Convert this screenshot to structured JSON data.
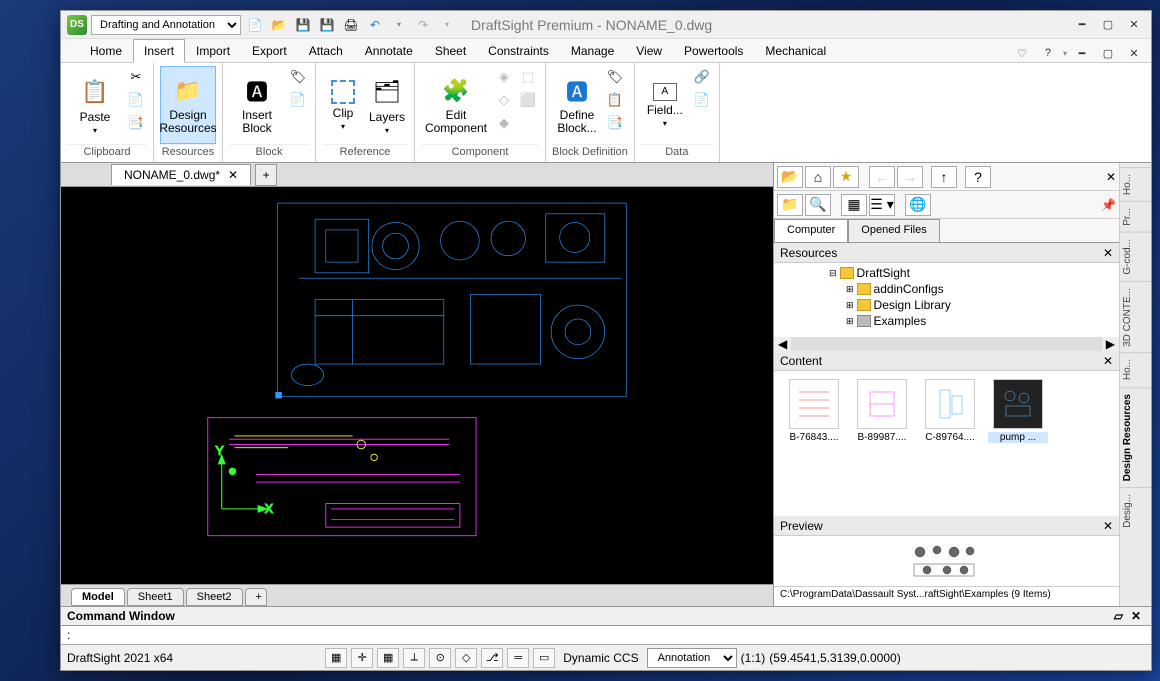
{
  "app": {
    "title": "DraftSight Premium - NONAME_0.dwg",
    "workspace_selected": "Drafting and Annotation",
    "logo_text": "DS"
  },
  "menu": {
    "tabs": [
      "Home",
      "Insert",
      "Import",
      "Export",
      "Attach",
      "Annotate",
      "Sheet",
      "Constraints",
      "Manage",
      "View",
      "Powertools",
      "Mechanical"
    ],
    "active": "Insert"
  },
  "ribbon": {
    "groups": [
      {
        "label": "Clipboard",
        "items": [
          {
            "big": "Paste",
            "sub": "▾"
          }
        ]
      },
      {
        "label": "Resources",
        "items": [
          {
            "big": "Design Resources",
            "active": true
          }
        ]
      },
      {
        "label": "Block",
        "items": [
          {
            "big": "Insert Block"
          }
        ]
      },
      {
        "label": "Reference",
        "items": [
          {
            "big": "Clip",
            "sub": "▾"
          },
          {
            "big": "Layers",
            "sub": "▾"
          }
        ]
      },
      {
        "label": "Component",
        "items": [
          {
            "big": "Edit Component"
          }
        ]
      },
      {
        "label": "Block Definition",
        "items": [
          {
            "big": "Define Block..."
          }
        ]
      },
      {
        "label": "Data",
        "items": [
          {
            "big": "Field...",
            "sub": "▾"
          }
        ]
      }
    ]
  },
  "document": {
    "tab_name": "NONAME_0.dwg*",
    "sheets": [
      "Model",
      "Sheet1",
      "Sheet2"
    ],
    "active_sheet": "Model"
  },
  "design_resources": {
    "panel_title": "Design Resources",
    "tabs_side": [
      "Ho...",
      "Pr...",
      "G-cod...",
      "3D CONTE...",
      "Ho...",
      "Design Resources",
      "Desig..."
    ],
    "sub_tabs": [
      "Computer",
      "Opened Files"
    ],
    "active_sub": "Computer",
    "tree_title": "Resources",
    "tree": [
      {
        "level": 3,
        "name": "DraftSight",
        "expanded": true
      },
      {
        "level": 4,
        "name": "addinConfigs",
        "expanded": false
      },
      {
        "level": 4,
        "name": "Design Library",
        "expanded": false
      },
      {
        "level": 4,
        "name": "Examples",
        "expanded": false,
        "dim": true
      }
    ],
    "content_title": "Content",
    "thumbs": [
      {
        "label": "B-76843...."
      },
      {
        "label": "B-89987...."
      },
      {
        "label": "C-89764...."
      },
      {
        "label": "pump ...",
        "selected": true
      }
    ],
    "preview_title": "Preview",
    "path": "C:\\ProgramData\\Dassault Syst...raftSight\\Examples (9 Items)"
  },
  "command": {
    "title": "Command Window",
    "prompt": ":"
  },
  "status": {
    "version": "DraftSight 2021 x64",
    "ccs": "Dynamic CCS",
    "annotation": "Annotation",
    "scale": "(1:1)",
    "coords": "(59.4541,5.3139,0.0000)"
  }
}
